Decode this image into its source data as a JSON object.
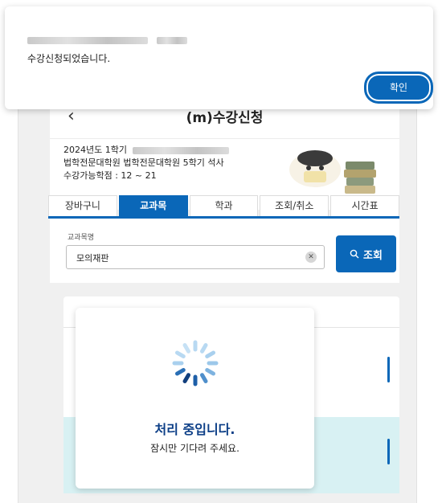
{
  "alert": {
    "message": "수강신청되었습니다.",
    "confirm_label": "확인"
  },
  "header": {
    "title": "(m)수강신청"
  },
  "info": {
    "semester": "2024년도 1학기",
    "program": "법학전문대학원 법학전문대학원 5학기 석사",
    "credits": "수강가능학점 : 12 ~ 21"
  },
  "tabs": [
    {
      "label": "장바구니"
    },
    {
      "label": "교과목"
    },
    {
      "label": "학과"
    },
    {
      "label": "조회/취소"
    },
    {
      "label": "시간표"
    }
  ],
  "search": {
    "label": "교과목명",
    "value": "모의재판",
    "button_label": "조회"
  },
  "loading": {
    "title": "처리 중입니다.",
    "subtitle": "잠시만 기다려 주세요."
  },
  "colors": {
    "primary": "#0a67b8",
    "loading_title": "#0d3f87",
    "band": "#d8f1f3"
  }
}
